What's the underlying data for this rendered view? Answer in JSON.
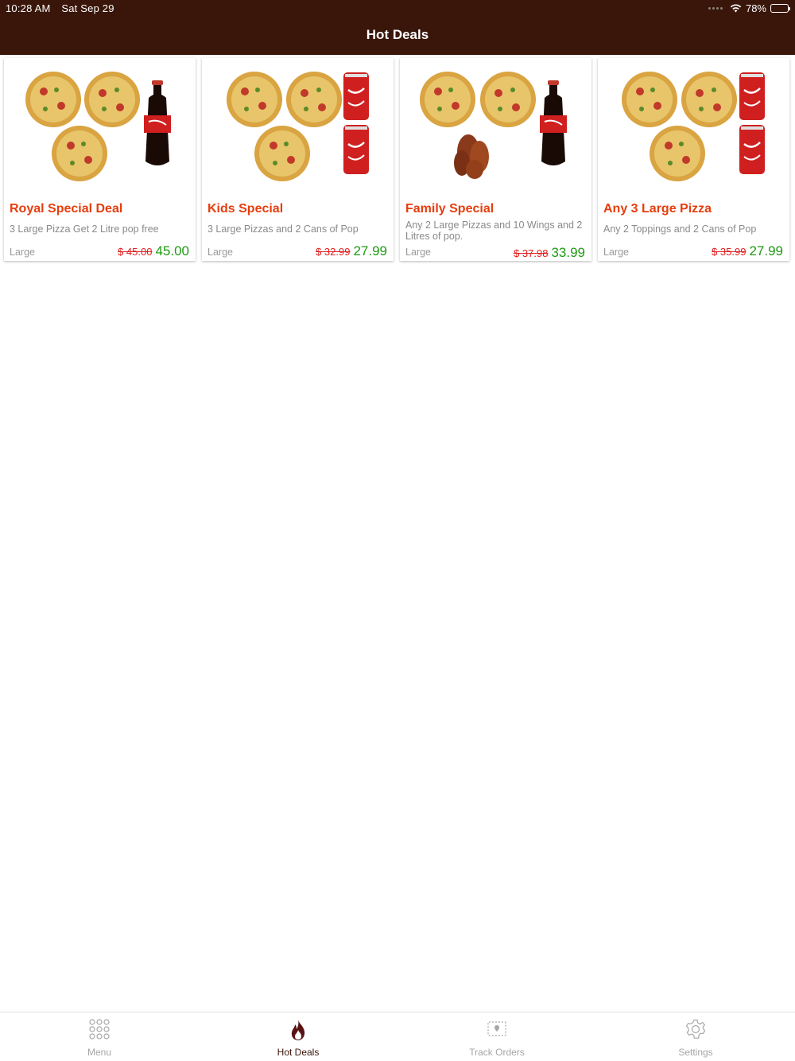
{
  "status_bar": {
    "time": "10:28 AM",
    "date": "Sat Sep 29",
    "battery": "78%",
    "battery_level": 0.78,
    "icons": [
      "signal-dots-icon",
      "wifi-icon",
      "battery-icon"
    ]
  },
  "header": {
    "title": "Hot Deals"
  },
  "colors": {
    "header_bg": "#3a160a",
    "deal_title": "#e63d0d",
    "old_price": "#e02020",
    "new_price": "#1e9a12",
    "active_tab": "#3a160a",
    "inactive_tab": "#a6a6a6"
  },
  "deals": [
    {
      "title": "Royal Special Deal",
      "description": "3 Large Pizza Get 2 Litre pop free",
      "size": "Large",
      "old_price": "$ 45.00",
      "new_price": "45.00",
      "image": [
        "pizza",
        "pizza",
        "pizza",
        "cola-bottle"
      ]
    },
    {
      "title": "Kids Special",
      "description": "3 Large Pizzas and 2 Cans of Pop",
      "size": "Large",
      "old_price": "$ 32.99",
      "new_price": "27.99",
      "image": [
        "pizza",
        "pizza",
        "pizza",
        "cola-can",
        "cola-can"
      ]
    },
    {
      "title": "Family Special",
      "description": "Any 2 Large Pizzas and 10 Wings and 2 Litres of pop.",
      "size": "Large",
      "old_price": "$ 37.98",
      "new_price": "33.99",
      "image": [
        "pizza",
        "pizza",
        "chicken-wings",
        "cola-bottle"
      ]
    },
    {
      "title": "Any 3 Large Pizza",
      "description": "Any 2 Toppings and 2 Cans of Pop",
      "size": "Large",
      "old_price": "$ 35.99",
      "new_price": "27.99",
      "image": [
        "pizza",
        "pizza",
        "pizza",
        "cola-can",
        "cola-can"
      ]
    }
  ],
  "tabs": [
    {
      "label": "Menu",
      "icon": "menu-grid-icon",
      "active": false
    },
    {
      "label": "Hot Deals",
      "icon": "flame-icon",
      "active": true
    },
    {
      "label": "Track Orders",
      "icon": "track-map-icon",
      "active": false
    },
    {
      "label": "Settings",
      "icon": "gear-icon",
      "active": false
    }
  ]
}
